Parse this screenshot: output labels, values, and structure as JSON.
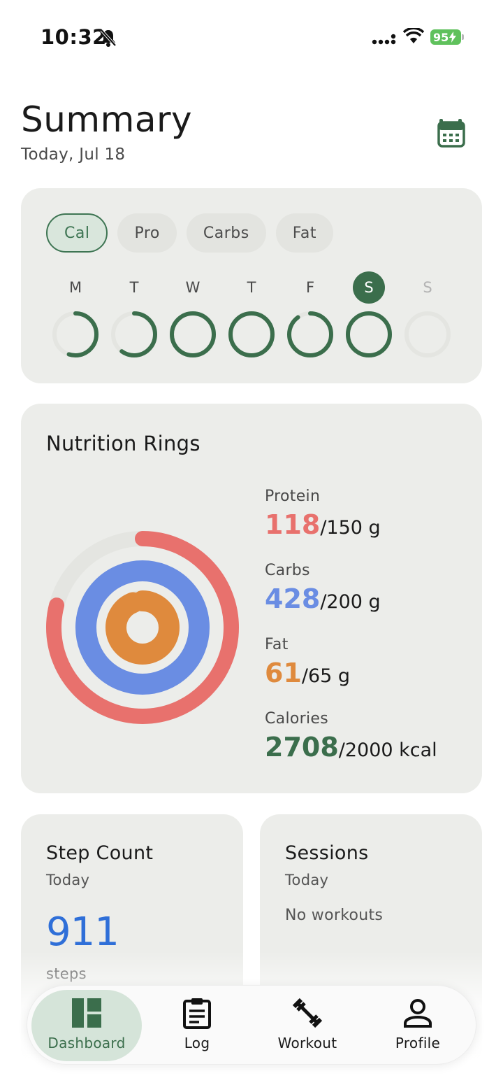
{
  "status_bar": {
    "time": "10:32",
    "battery": "95"
  },
  "header": {
    "title": "Summary",
    "subtitle": "Today, Jul 18",
    "calendar_icon": "calendar-icon"
  },
  "week_card": {
    "chips": [
      {
        "label": "Cal",
        "active": true
      },
      {
        "label": "Pro",
        "active": false
      },
      {
        "label": "Carbs",
        "active": false
      },
      {
        "label": "Fat",
        "active": false
      }
    ],
    "days": [
      {
        "label": "M",
        "progress": 0.55,
        "state": "normal"
      },
      {
        "label": "T",
        "progress": 0.6,
        "state": "normal"
      },
      {
        "label": "W",
        "progress": 1.0,
        "state": "normal"
      },
      {
        "label": "T",
        "progress": 1.0,
        "state": "normal"
      },
      {
        "label": "F",
        "progress": 0.9,
        "state": "normal"
      },
      {
        "label": "S",
        "progress": 1.0,
        "state": "selected"
      },
      {
        "label": "S",
        "progress": 0,
        "state": "muted"
      }
    ]
  },
  "nutrition": {
    "title": "Nutrition Rings",
    "macros": [
      {
        "label": "Protein",
        "current": "118",
        "target": "/150 g",
        "color": "#e8716d",
        "fraction": 0.79
      },
      {
        "label": "Carbs",
        "current": "428",
        "target": "/200 g",
        "color": "#6a8de3",
        "fraction": 1.0
      },
      {
        "label": "Fat",
        "current": "61",
        "target": "/65 g",
        "color": "#df8a3d",
        "fraction": 0.94
      },
      {
        "label": "Calories",
        "current": "2708",
        "target": "/2000 kcal",
        "color": "#3b6e4c",
        "fraction": 1.0
      }
    ],
    "colors": {
      "protein": "#e8716d",
      "carbs": "#6a8de3",
      "fat": "#df8a3d",
      "track": "#e4e5e1"
    }
  },
  "steps": {
    "title": "Step Count",
    "subtitle": "Today",
    "value": "911",
    "unit": "steps"
  },
  "sessions": {
    "title": "Sessions",
    "subtitle": "Today",
    "empty_text": "No workouts"
  },
  "tab_bar": {
    "tabs": [
      {
        "label": "Dashboard",
        "icon": "dashboard-icon",
        "active": true
      },
      {
        "label": "Log",
        "icon": "clipboard-icon",
        "active": false
      },
      {
        "label": "Workout",
        "icon": "dumbbell-icon",
        "active": false
      },
      {
        "label": "Profile",
        "icon": "person-icon",
        "active": false
      }
    ]
  },
  "colors": {
    "accent": "#3b6e4c",
    "steps": "#2f6fd8"
  }
}
